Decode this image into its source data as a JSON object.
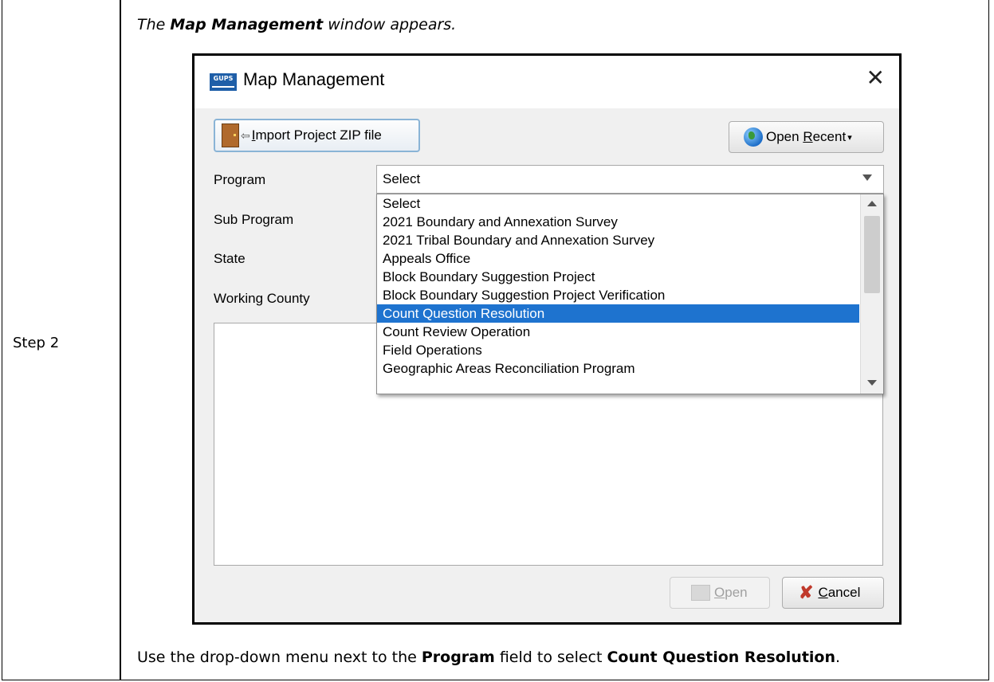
{
  "document": {
    "step_label": "Step 2",
    "intro_prefix": "The ",
    "intro_bold": "Map Management",
    "intro_suffix": " window appears.",
    "instruction_prefix": "Use the drop-down menu next to the ",
    "instruction_field": "Program",
    "instruction_mid": " field to select ",
    "instruction_value": "Count Question Resolution",
    "instruction_end": "."
  },
  "dialog": {
    "app_icon_text": "GUPS",
    "title": "Map Management",
    "close_glyph": "✕",
    "import_button": {
      "pre": "",
      "mnemonic": "I",
      "post": "mport Project ZIP file"
    },
    "open_recent_button": {
      "pre": "Open ",
      "mnemonic": "R",
      "post": "ecent",
      "caret": "▾"
    },
    "fields": {
      "program": "Program",
      "sub_program": "Sub Program",
      "state": "State",
      "working_county": "Working County"
    },
    "program_select": {
      "value": "Select",
      "options": [
        "Select",
        "2021 Boundary and Annexation Survey",
        "2021 Tribal Boundary and Annexation Survey",
        "Appeals Office",
        "Block Boundary Suggestion Project",
        "Block Boundary Suggestion Project Verification",
        "Count Question Resolution",
        "Count Review Operation",
        "Field Operations",
        "Geographic Areas Reconciliation Program"
      ],
      "highlighted": "Count Question Resolution"
    },
    "open_button": {
      "mnemonic": "O",
      "post": "pen",
      "enabled": false
    },
    "cancel_button": {
      "mnemonic": "C",
      "post": "ancel"
    }
  },
  "colors": {
    "highlight": "#1e73cf",
    "app_icon": "#1f5fa8",
    "cancel_icon": "#c0392b"
  }
}
